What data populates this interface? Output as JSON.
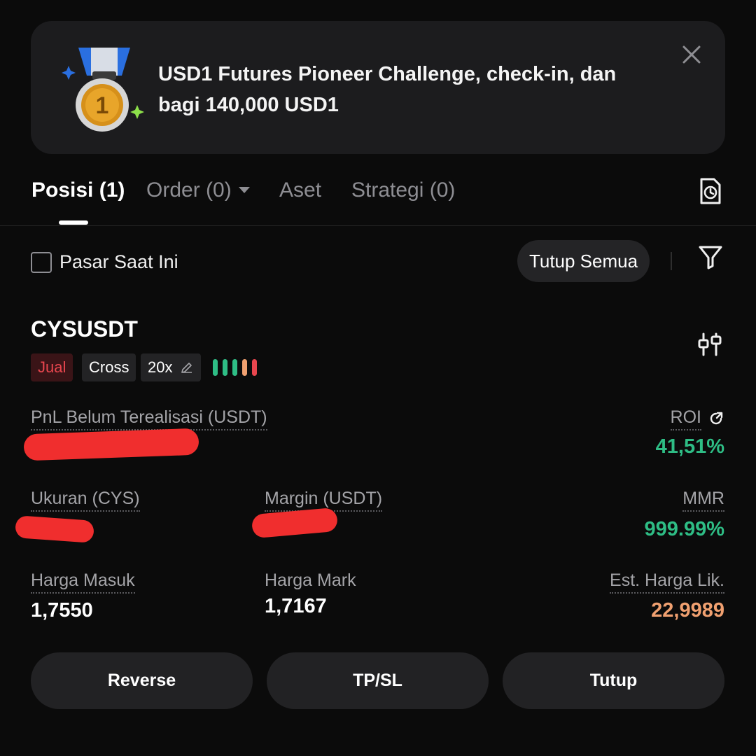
{
  "banner": {
    "text": "USD1 Futures Pioneer Challenge, check-in, dan bagi 140,000 USD1",
    "medal_icon": "first-place-medal-icon",
    "close_icon": "close-icon"
  },
  "tabs": [
    {
      "label": "Posisi (1)",
      "active": true
    },
    {
      "label": "Order (0)",
      "dropdown": true
    },
    {
      "label": "Aset"
    },
    {
      "label": "Strategi (0)"
    }
  ],
  "toolbar": {
    "current_market_label": "Pasar Saat Ini",
    "current_market_checked": false,
    "close_all_label": "Tutup Semua",
    "history_icon": "order-history-icon",
    "filter_icon": "filter-icon"
  },
  "position": {
    "symbol": "CYSUSDT",
    "side": "Jual",
    "margin_mode": "Cross",
    "leverage": "20x",
    "adl_colors": [
      "#2ebd85",
      "#2ebd85",
      "#2ebd85",
      "#f0a070",
      "#e8464e"
    ],
    "pnl_label": "PnL Belum Terealisasi (USDT)",
    "pnl_value": "",
    "roi_label": "ROI",
    "roi_value": "41,51%",
    "size_label": "Ukuran (CYS)",
    "size_value": "",
    "margin_label": "Margin (USDT)",
    "margin_value": "",
    "mmr_label": "MMR",
    "mmr_value": "999.99%",
    "entry_label": "Harga Masuk",
    "entry_value": "1,7550",
    "mark_label": "Harga Mark",
    "mark_value": "1,7167",
    "liq_label": "Est. Harga Lik.",
    "liq_value": "22,9989"
  },
  "actions": {
    "reverse": "Reverse",
    "tpsl": "TP/SL",
    "close": "Tutup"
  },
  "colors": {
    "background": "#0b0b0b",
    "positive": "#2ebd85",
    "negative": "#e8464e",
    "warning": "#f0a070"
  }
}
